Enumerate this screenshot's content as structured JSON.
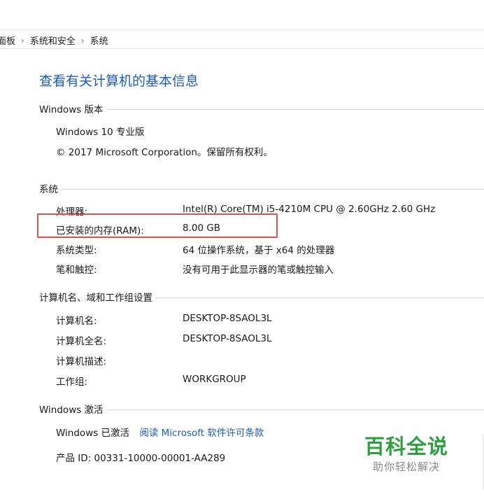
{
  "breadcrumb": {
    "items": [
      "面板",
      "系统和安全",
      "系统"
    ],
    "separator": "›"
  },
  "page_title": "查看有关计算机的基本信息",
  "windows_edition": {
    "heading": "Windows 版本",
    "edition": "Windows 10 专业版",
    "copyright": "© 2017 Microsoft Corporation。保留所有权利。"
  },
  "system": {
    "heading": "系统",
    "rows": [
      {
        "key": "处理器:",
        "value": "Intel(R) Core(TM) i5-4210M CPU @ 2.60GHz   2.60 GHz"
      },
      {
        "key": "已安装的内存(RAM):",
        "value": "8.00 GB"
      },
      {
        "key": "系统类型:",
        "value": "64 位操作系统，基于 x64 的处理器"
      },
      {
        "key": "笔和触控:",
        "value": "没有可用于此显示器的笔或触控输入"
      }
    ]
  },
  "computer_name": {
    "heading": "计算机名、域和工作组设置",
    "rows": [
      {
        "key": "计算机名:",
        "value": "DESKTOP-8SAOL3L"
      },
      {
        "key": "计算机全名:",
        "value": "DESKTOP-8SAOL3L"
      },
      {
        "key": "计算机描述:",
        "value": ""
      },
      {
        "key": "工作组:",
        "value": "WORKGROUP"
      }
    ]
  },
  "activation": {
    "heading": "Windows 激活",
    "status": "Windows 已激活",
    "license_link": "阅读 Microsoft 软件许可条款",
    "product_id": "产品 ID: 00331-10000-00001-AA289"
  },
  "watermark": {
    "main": "百科全说",
    "sub": "助你轻松解决"
  },
  "colors": {
    "title_blue": "#1c5cb0",
    "highlight_red": "#d9534f",
    "watermark_green": "#2e9e3e"
  }
}
